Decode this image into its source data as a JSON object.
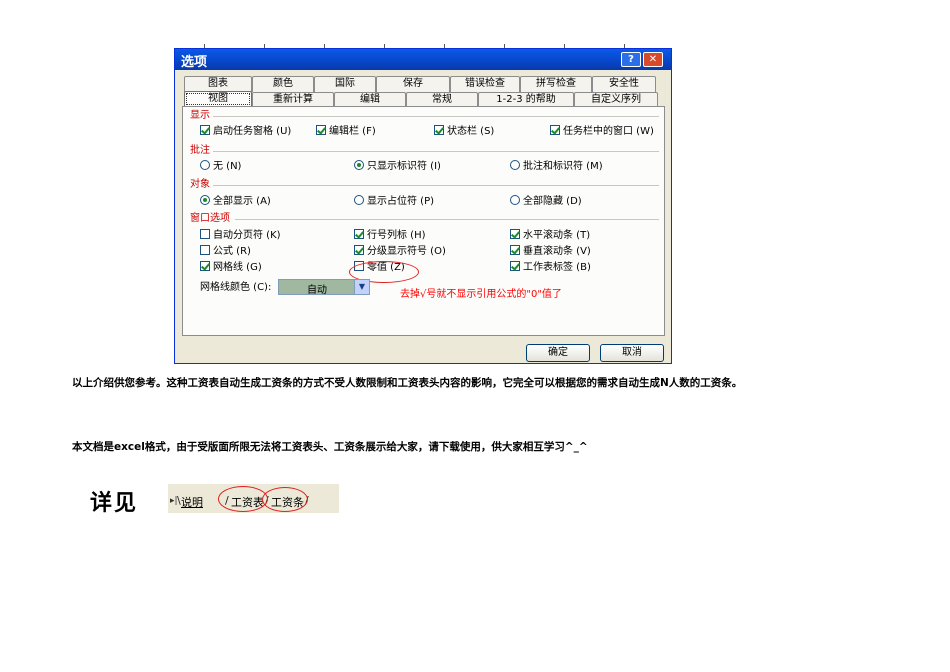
{
  "dialog": {
    "title": "选项",
    "help_label": "?",
    "close_label": "✕",
    "tabs_row1": [
      "图表",
      "颜色",
      "国际",
      "保存",
      "错误检查",
      "拼写检查",
      "安全性"
    ],
    "tabs_row2": [
      "视图",
      "重新计算",
      "编辑",
      "常规",
      "1-2-3 的帮助",
      "自定义序列"
    ],
    "active_tab": "视图",
    "groups": {
      "display": {
        "label": "显示",
        "options": [
          {
            "label": "启动任务窗格 (U)",
            "checked": true
          },
          {
            "label": "编辑栏 (F)",
            "checked": true
          },
          {
            "label": "状态栏 (S)",
            "checked": true
          },
          {
            "label": "任务栏中的窗口 (W)",
            "checked": true
          }
        ]
      },
      "comments": {
        "label": "批注",
        "options": [
          {
            "label": "无 (N)",
            "selected": false
          },
          {
            "label": "只显示标识符 (I)",
            "selected": true
          },
          {
            "label": "批注和标识符 (M)",
            "selected": false
          }
        ]
      },
      "objects": {
        "label": "对象",
        "options": [
          {
            "label": "全部显示 (A)",
            "selected": true
          },
          {
            "label": "显示占位符 (P)",
            "selected": false
          },
          {
            "label": "全部隐藏 (D)",
            "selected": false
          }
        ]
      },
      "window": {
        "label": "窗口选项",
        "options": [
          {
            "label": "自动分页符 (K)",
            "checked": false
          },
          {
            "label": "行号列标 (H)",
            "checked": true
          },
          {
            "label": "水平滚动条 (T)",
            "checked": true
          },
          {
            "label": "公式 (R)",
            "checked": false
          },
          {
            "label": "分级显示符号 (O)",
            "checked": true
          },
          {
            "label": "垂直滚动条 (V)",
            "checked": true
          },
          {
            "label": "网格线 (G)",
            "checked": true
          },
          {
            "label": "零值 (Z)",
            "checked": false
          },
          {
            "label": "工作表标签 (B)",
            "checked": true
          }
        ]
      }
    },
    "gridline_color_label": "网格线颜色 (C):",
    "gridline_color_value": "自动",
    "annotation": "去掉√号就不显示引用公式的\"0\"值了",
    "ok_label": "确定",
    "cancel_label": "取消"
  },
  "paragraphs": {
    "p1": "以上介绍供您参考。这种工资表自动生成工资条的方式不受人数限制和工资表头内容的影响，它完全可以根据您的需求自动生成N人数的工资条。",
    "p2": "本文档是excel格式，由于受版面所限无法将工资表头、工资条展示给大家，请下载使用，供大家相互学习^_^"
  },
  "see_detail": "详见",
  "sheet_tabs": {
    "nav": "▸|",
    "tabs": [
      "说明",
      "工资表",
      "工资条"
    ]
  }
}
